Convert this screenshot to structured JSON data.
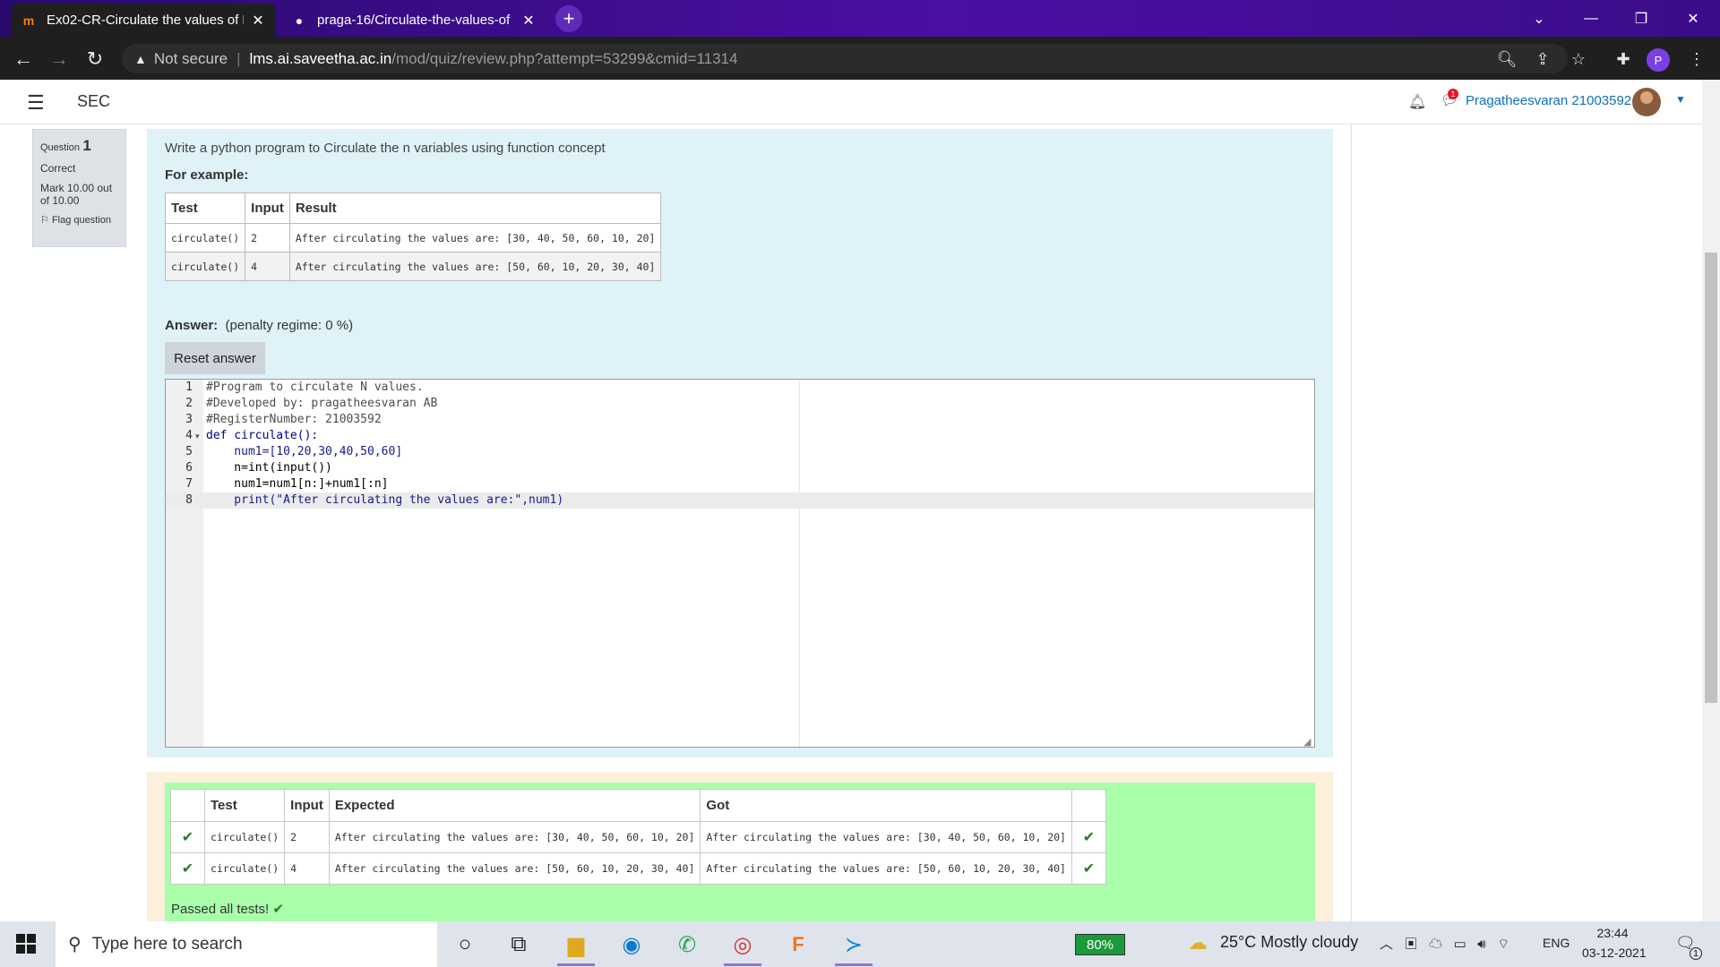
{
  "browser": {
    "tabs": [
      {
        "title": "Ex02-CR-Circulate the values of N",
        "icon": "moodle-icon"
      },
      {
        "title": "praga-16/Circulate-the-values-of",
        "icon": "github-icon"
      }
    ],
    "new_tab": "+",
    "not_secure": "Not secure",
    "url_host": "lms.ai.saveetha.ac.in",
    "url_path": "/mod/quiz/review.php?attempt=53299&cmid=11314",
    "profile_initial": "P"
  },
  "header": {
    "site_name": "SEC",
    "user_name": "Pragatheesvaran 21003592",
    "message_badge": "1"
  },
  "question_info": {
    "label": "Question",
    "number": "1",
    "status": "Correct",
    "mark": "Mark 10.00 out of 10.00",
    "flag": "Flag question"
  },
  "question": {
    "text": "Write a python program to Circulate the n variables using function concept",
    "for_example": "For example:",
    "example_headers": [
      "Test",
      "Input",
      "Result"
    ],
    "example_rows": [
      [
        "circulate()",
        "2",
        "After circulating the values are: [30, 40, 50, 60, 10, 20]"
      ],
      [
        "circulate()",
        "4",
        "After circulating the values are: [50, 60, 10, 20, 30, 40]"
      ]
    ],
    "answer_label": "Answer:",
    "penalty": "(penalty regime: 0 %)",
    "reset_button": "Reset answer"
  },
  "code": {
    "line_numbers": [
      "1",
      "2",
      "3",
      "4",
      "5",
      "6",
      "7",
      "8"
    ],
    "lines": [
      "#Program to circulate N values.",
      "#Developed by: pragatheesvaran AB",
      "#RegisterNumber: 21003592",
      "def circulate():",
      "    num1=[10,20,30,40,50,60]",
      "    n=int(input())",
      "    num1=num1[n:]+num1[:n]",
      "    print(\"After circulating the values are:\",num1)"
    ]
  },
  "results": {
    "headers": [
      "",
      "Test",
      "Input",
      "Expected",
      "Got",
      ""
    ],
    "rows": [
      [
        "circulate()",
        "2",
        "After circulating the values are: [30, 40, 50, 60, 10, 20]",
        "After circulating the values are: [30, 40, 50, 60, 10, 20]"
      ],
      [
        "circulate()",
        "4",
        "After circulating the values are: [50, 60, 10, 20, 30, 40]",
        "After circulating the values are: [50, 60, 10, 20, 30, 40]"
      ]
    ],
    "passed": "Passed all tests!"
  },
  "taskbar": {
    "search_placeholder": "Type here to search",
    "battery": "80%",
    "weather": "25°C  Mostly cloudy",
    "language": "ENG",
    "time": "23:44",
    "date": "03-12-2021",
    "notification_count": "1"
  }
}
